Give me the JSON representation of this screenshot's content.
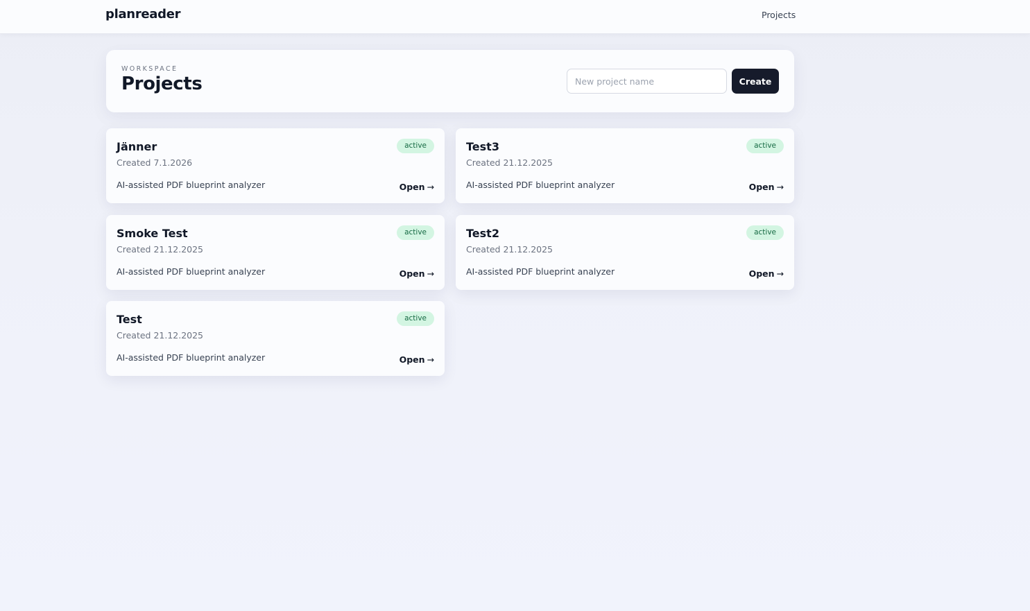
{
  "app": {
    "brand": "planreader",
    "nav": {
      "projects_link": "Projects"
    }
  },
  "header": {
    "eyebrow": "WORKSPACE",
    "title": "Projects",
    "new_project_input": {
      "value": "",
      "placeholder": "New project name"
    },
    "create_label": "Create"
  },
  "projects": [
    {
      "name": "Jänner",
      "created": "Created 7.1.2026",
      "status": "active",
      "description": "AI-assisted PDF blueprint analyzer",
      "open_label": "Open",
      "open_icon": "→"
    },
    {
      "name": "Test3",
      "created": "Created 21.12.2025",
      "status": "active",
      "description": "AI-assisted PDF blueprint analyzer",
      "open_label": "Open",
      "open_icon": "→"
    },
    {
      "name": "Smoke Test",
      "created": "Created 21.12.2025",
      "status": "active",
      "description": "AI-assisted PDF blueprint analyzer",
      "open_label": "Open",
      "open_icon": "→"
    },
    {
      "name": "Test2",
      "created": "Created 21.12.2025",
      "status": "active",
      "description": "AI-assisted PDF blueprint analyzer",
      "open_label": "Open",
      "open_icon": "→"
    },
    {
      "name": "Test",
      "created": "Created 21.12.2025",
      "status": "active",
      "description": "AI-assisted PDF blueprint analyzer",
      "open_label": "Open",
      "open_icon": "→"
    }
  ],
  "colors": {
    "primary_button": "#161b2b",
    "badge_bg": "#d3f5e2",
    "badge_text": "#166a43",
    "page_bg": "#eef0f8"
  }
}
